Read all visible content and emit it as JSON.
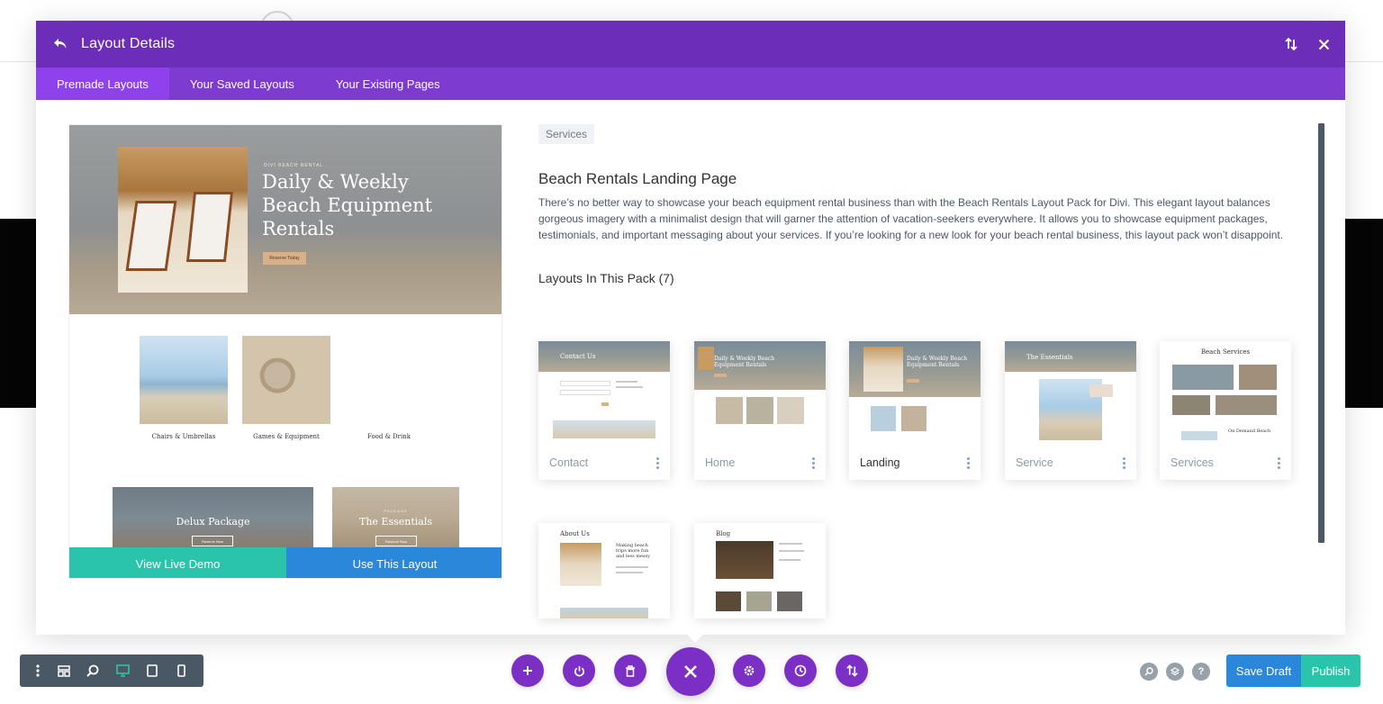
{
  "modal": {
    "title": "Layout Details",
    "back_icon": "undo-arrow-icon",
    "sort_icon": "sort-arrows-icon",
    "close_icon": "close-icon"
  },
  "tabs": [
    {
      "label": "Premade Layouts",
      "active": true
    },
    {
      "label": "Your Saved Layouts",
      "active": false
    },
    {
      "label": "Your Existing Pages",
      "active": false
    }
  ],
  "preview": {
    "hero_eyebrow": "DIVI BEACH RENTAL",
    "hero_title": "Daily & Weekly Beach Equipment Rentals",
    "hero_button": "Reserve Today",
    "categories": [
      "Chairs & Umbrellas",
      "Games & Equipment",
      "Food & Drink"
    ],
    "packages": [
      {
        "eyebrow": "",
        "name": "Delux Package",
        "button": "Reserve Now"
      },
      {
        "eyebrow": "PACKAGE",
        "name": "The Essentials",
        "button": "Reserve Now"
      }
    ],
    "demo_button": "View Live Demo",
    "use_button": "Use This Layout"
  },
  "details": {
    "category": "Services",
    "title": "Beach Rentals Landing Page",
    "description": "There’s no better way to showcase your beach equipment rental business than with the Beach Rentals Layout Pack for Divi. This elegant layout balances gorgeous imagery with a minimalist design that will garner the attention of vacation-seekers everywhere. It allows you to showcase equipment packages, testimonials, and important messaging about your services. If you’re looking for a new look for your beach rental business, this layout pack won’t disappoint.",
    "pack_heading": "Layouts In This Pack (7)"
  },
  "layouts": [
    {
      "name": "Contact",
      "active": false,
      "thumb_text": "Contact Us"
    },
    {
      "name": "Home",
      "active": false,
      "thumb_text": "Daily & Weekly Beach Equipment Rentals"
    },
    {
      "name": "Landing",
      "active": true,
      "thumb_text": "Daily & Weekly Beach Equipment Rentals"
    },
    {
      "name": "Service",
      "active": false,
      "thumb_text": "The Essentials"
    },
    {
      "name": "Services",
      "active": false,
      "thumb_text": "Beach Services"
    },
    {
      "name": "About Us",
      "active": false,
      "thumb_text": "About Us"
    },
    {
      "name": "Blog",
      "active": false,
      "thumb_text": "Blog"
    }
  ],
  "thumb_extra": {
    "services_sub": "On Demand Beach",
    "about_body": "Making beach trips more fun and less messy"
  },
  "toolbar": {
    "left_icons": [
      "more-vertical-icon",
      "layout-grid-icon",
      "zoom-icon",
      "desktop-view-icon",
      "tablet-view-icon",
      "phone-view-icon"
    ],
    "center_icons": [
      "add-icon",
      "power-icon",
      "trash-icon",
      "close-icon",
      "settings-icon",
      "history-icon",
      "portability-icon"
    ],
    "right_icons": [
      "search-icon",
      "layers-icon",
      "help-icon"
    ],
    "save_draft": "Save Draft",
    "publish": "Publish"
  },
  "colors": {
    "header_purple": "#6c2eb9",
    "tab_purple": "#7e3bd0",
    "active_tab": "#8f42ec",
    "teal": "#29c4a9",
    "blue": "#2b87da",
    "toolbar_gray": "#4a5866"
  }
}
